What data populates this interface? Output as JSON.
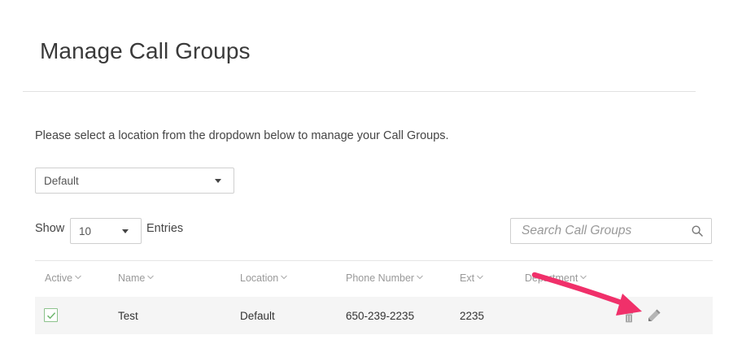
{
  "page": {
    "title": "Manage Call Groups",
    "instructions": "Please select a location from the dropdown below to manage your Call Groups."
  },
  "location_select": {
    "value": "Default"
  },
  "entries": {
    "show_label": "Show",
    "value": "10",
    "entries_label": "Entries"
  },
  "search": {
    "placeholder": "Search Call Groups"
  },
  "table": {
    "columns": [
      "Active",
      "Name",
      "Location",
      "Phone Number",
      "Ext",
      "Department"
    ],
    "rows": [
      {
        "active": true,
        "name": "Test",
        "location": "Default",
        "phone": "650-239-2235",
        "ext": "2235",
        "department": ""
      }
    ]
  },
  "icons": {
    "dropdown": "chevron-down-icon",
    "search": "search-icon",
    "checkbox": "check-icon",
    "delete": "trash-icon",
    "edit": "pencil-icon",
    "annotation": "arrow-annotation"
  },
  "colors": {
    "annotation_arrow": "#f0306a",
    "checkbox_check": "#6db66d",
    "row_background": "#f5f5f5",
    "header_text": "#999999"
  }
}
